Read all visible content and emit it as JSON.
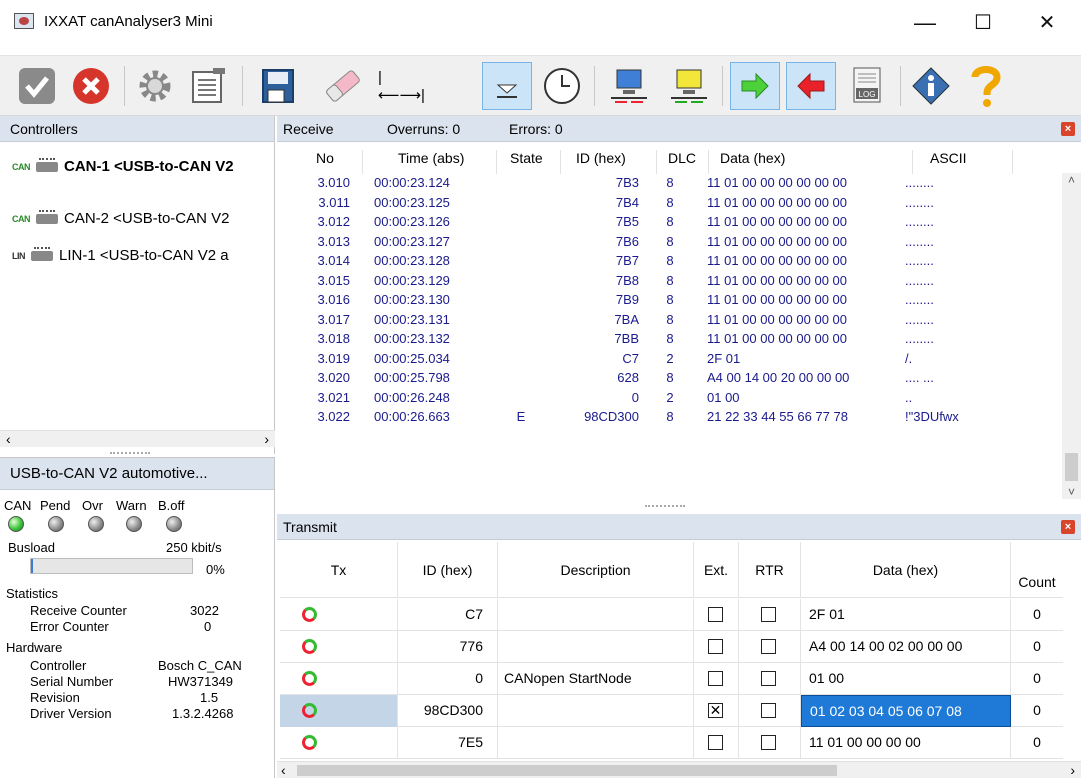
{
  "window": {
    "title": "IXXAT canAnalyser3 Mini",
    "minimize": "—",
    "maximize": "☐",
    "close": "✕"
  },
  "toolbar": {
    "items": [
      "start",
      "stop",
      "settings",
      "options",
      "save",
      "clear",
      "time-span",
      "autoscroll",
      "clock",
      "receive-filter",
      "transmit-filter",
      "rx-green",
      "tx-red",
      "log",
      "info",
      "help"
    ],
    "span_glyph": "|⟵⟶|",
    "log_label": "LOG"
  },
  "controllers": {
    "header": "Controllers",
    "items": [
      {
        "tag": "CAN",
        "label": "CAN-1  <USB-to-CAN V2",
        "bold": true
      },
      {
        "tag": "CAN",
        "label": "CAN-2  <USB-to-CAN V2",
        "bold": false
      },
      {
        "tag": "LIN",
        "label": "LIN-1  <USB-to-CAN V2 a",
        "bold": false
      }
    ]
  },
  "device": {
    "header": "USB-to-CAN V2 automotive...",
    "leds": {
      "labels": [
        "CAN",
        "Pend",
        "Ovr",
        "Warn",
        "B.off"
      ],
      "on": [
        true,
        false,
        false,
        false,
        false
      ]
    },
    "busload_label": "Busload",
    "bitrate": "250 kbit/s",
    "busload_value": "0%",
    "busload_fraction": 0.01,
    "statistics_label": "Statistics",
    "stats": [
      {
        "k": "Receive Counter",
        "v": "3022"
      },
      {
        "k": "Error Counter",
        "v": "0"
      }
    ],
    "hardware_label": "Hardware",
    "hardware": [
      {
        "k": "Controller",
        "v": "Bosch C_CAN"
      },
      {
        "k": "Serial Number",
        "v": "HW371349"
      },
      {
        "k": "Revision",
        "v": "1.5"
      },
      {
        "k": "Driver Version",
        "v": "1.3.2.4268"
      }
    ]
  },
  "receive": {
    "title": "Receive",
    "overruns": "Overruns: 0",
    "errors": "Errors: 0",
    "columns": [
      "No",
      "Time (abs)",
      "State",
      "ID (hex)",
      "DLC",
      "Data (hex)",
      "ASCII"
    ],
    "rows": [
      [
        "3.010",
        "00:00:23.124",
        "",
        "7B3",
        "8",
        "11 01 00 00 00 00 00 00",
        "........"
      ],
      [
        "3.011",
        "00:00:23.125",
        "",
        "7B4",
        "8",
        "11 01 00 00 00 00 00 00",
        "........"
      ],
      [
        "3.012",
        "00:00:23.126",
        "",
        "7B5",
        "8",
        "11 01 00 00 00 00 00 00",
        "........"
      ],
      [
        "3.013",
        "00:00:23.127",
        "",
        "7B6",
        "8",
        "11 01 00 00 00 00 00 00",
        "........"
      ],
      [
        "3.014",
        "00:00:23.128",
        "",
        "7B7",
        "8",
        "11 01 00 00 00 00 00 00",
        "........"
      ],
      [
        "3.015",
        "00:00:23.129",
        "",
        "7B8",
        "8",
        "11 01 00 00 00 00 00 00",
        "........"
      ],
      [
        "3.016",
        "00:00:23.130",
        "",
        "7B9",
        "8",
        "11 01 00 00 00 00 00 00",
        "........"
      ],
      [
        "3.017",
        "00:00:23.131",
        "",
        "7BA",
        "8",
        "11 01 00 00 00 00 00 00",
        "........"
      ],
      [
        "3.018",
        "00:00:23.132",
        "",
        "7BB",
        "8",
        "11 01 00 00 00 00 00 00",
        "........"
      ],
      [
        "3.019",
        "00:00:25.034",
        "",
        "C7",
        "2",
        "2F 01",
        "/."
      ],
      [
        "3.020",
        "00:00:25.798",
        "",
        "628",
        "8",
        "A4 00 14 00 20 00 00 00",
        ".... ..."
      ],
      [
        "3.021",
        "00:00:26.248",
        "",
        "0",
        "2",
        "01 00",
        ".."
      ],
      [
        "3.022",
        "00:00:26.663",
        "E",
        "98CD300",
        "8",
        "21 22 33 44 55 66 77 78",
        "!\"3DUfwx"
      ]
    ]
  },
  "transmit": {
    "title": "Transmit",
    "columns": [
      "Tx",
      "ID (hex)",
      "Description",
      "Ext.",
      "RTR",
      "Data (hex)",
      "Count"
    ],
    "rows": [
      {
        "id": "C7",
        "desc": "",
        "ext": false,
        "rtr": false,
        "data": "2F 01",
        "count": "0",
        "selected": false
      },
      {
        "id": "776",
        "desc": "",
        "ext": false,
        "rtr": false,
        "data": "A4 00 14 00 02 00 00 00",
        "count": "0",
        "selected": false
      },
      {
        "id": "0",
        "desc": "CANopen StartNode",
        "ext": false,
        "rtr": false,
        "data": "01 00",
        "count": "0",
        "selected": false
      },
      {
        "id": "98CD300",
        "desc": "",
        "ext": true,
        "rtr": false,
        "data": "01 02 03 04 05 06 07 08",
        "count": "0",
        "selected": true
      },
      {
        "id": "7E5",
        "desc": "",
        "ext": false,
        "rtr": false,
        "data": "11 01 00 00 00 00",
        "count": "0",
        "selected": false
      }
    ]
  }
}
